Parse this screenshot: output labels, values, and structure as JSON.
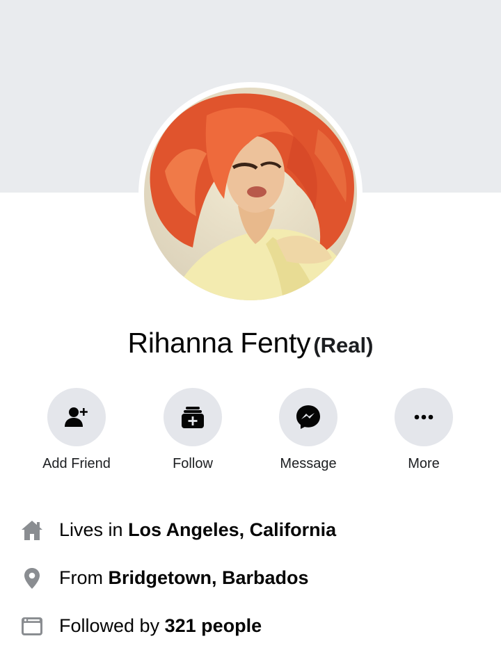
{
  "profile": {
    "name": "Rihanna Fenty",
    "tag": "(Real)"
  },
  "actions": [
    {
      "label": "Add Friend",
      "icon": "add-friend-icon"
    },
    {
      "label": "Follow",
      "icon": "follow-icon"
    },
    {
      "label": "Message",
      "icon": "messenger-icon"
    },
    {
      "label": "More",
      "icon": "more-dots-icon"
    }
  ],
  "info": [
    {
      "prefix": "Lives in ",
      "value": "Los Angeles, California",
      "icon": "home-icon"
    },
    {
      "prefix": "From ",
      "value": "Bridgetown, Barbados",
      "icon": "location-pin-icon"
    },
    {
      "prefix": "Followed by ",
      "value": "321 people",
      "icon": "followers-card-icon"
    }
  ],
  "colors": {
    "cover": "#e9ebee",
    "button_bg": "#e4e6eb",
    "icon_dark": "#050505",
    "icon_gray": "#8a8d91"
  }
}
